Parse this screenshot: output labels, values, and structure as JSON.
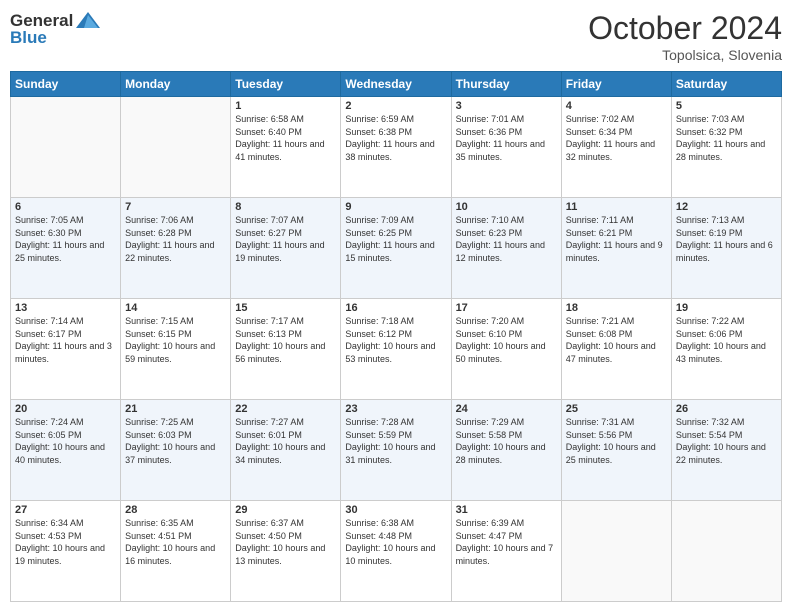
{
  "header": {
    "logo_general": "General",
    "logo_blue": "Blue",
    "month": "October 2024",
    "location": "Topolsica, Slovenia"
  },
  "days_of_week": [
    "Sunday",
    "Monday",
    "Tuesday",
    "Wednesday",
    "Thursday",
    "Friday",
    "Saturday"
  ],
  "weeks": [
    [
      {
        "num": "",
        "info": ""
      },
      {
        "num": "",
        "info": ""
      },
      {
        "num": "1",
        "info": "Sunrise: 6:58 AM\nSunset: 6:40 PM\nDaylight: 11 hours and 41 minutes."
      },
      {
        "num": "2",
        "info": "Sunrise: 6:59 AM\nSunset: 6:38 PM\nDaylight: 11 hours and 38 minutes."
      },
      {
        "num": "3",
        "info": "Sunrise: 7:01 AM\nSunset: 6:36 PM\nDaylight: 11 hours and 35 minutes."
      },
      {
        "num": "4",
        "info": "Sunrise: 7:02 AM\nSunset: 6:34 PM\nDaylight: 11 hours and 32 minutes."
      },
      {
        "num": "5",
        "info": "Sunrise: 7:03 AM\nSunset: 6:32 PM\nDaylight: 11 hours and 28 minutes."
      }
    ],
    [
      {
        "num": "6",
        "info": "Sunrise: 7:05 AM\nSunset: 6:30 PM\nDaylight: 11 hours and 25 minutes."
      },
      {
        "num": "7",
        "info": "Sunrise: 7:06 AM\nSunset: 6:28 PM\nDaylight: 11 hours and 22 minutes."
      },
      {
        "num": "8",
        "info": "Sunrise: 7:07 AM\nSunset: 6:27 PM\nDaylight: 11 hours and 19 minutes."
      },
      {
        "num": "9",
        "info": "Sunrise: 7:09 AM\nSunset: 6:25 PM\nDaylight: 11 hours and 15 minutes."
      },
      {
        "num": "10",
        "info": "Sunrise: 7:10 AM\nSunset: 6:23 PM\nDaylight: 11 hours and 12 minutes."
      },
      {
        "num": "11",
        "info": "Sunrise: 7:11 AM\nSunset: 6:21 PM\nDaylight: 11 hours and 9 minutes."
      },
      {
        "num": "12",
        "info": "Sunrise: 7:13 AM\nSunset: 6:19 PM\nDaylight: 11 hours and 6 minutes."
      }
    ],
    [
      {
        "num": "13",
        "info": "Sunrise: 7:14 AM\nSunset: 6:17 PM\nDaylight: 11 hours and 3 minutes."
      },
      {
        "num": "14",
        "info": "Sunrise: 7:15 AM\nSunset: 6:15 PM\nDaylight: 10 hours and 59 minutes."
      },
      {
        "num": "15",
        "info": "Sunrise: 7:17 AM\nSunset: 6:13 PM\nDaylight: 10 hours and 56 minutes."
      },
      {
        "num": "16",
        "info": "Sunrise: 7:18 AM\nSunset: 6:12 PM\nDaylight: 10 hours and 53 minutes."
      },
      {
        "num": "17",
        "info": "Sunrise: 7:20 AM\nSunset: 6:10 PM\nDaylight: 10 hours and 50 minutes."
      },
      {
        "num": "18",
        "info": "Sunrise: 7:21 AM\nSunset: 6:08 PM\nDaylight: 10 hours and 47 minutes."
      },
      {
        "num": "19",
        "info": "Sunrise: 7:22 AM\nSunset: 6:06 PM\nDaylight: 10 hours and 43 minutes."
      }
    ],
    [
      {
        "num": "20",
        "info": "Sunrise: 7:24 AM\nSunset: 6:05 PM\nDaylight: 10 hours and 40 minutes."
      },
      {
        "num": "21",
        "info": "Sunrise: 7:25 AM\nSunset: 6:03 PM\nDaylight: 10 hours and 37 minutes."
      },
      {
        "num": "22",
        "info": "Sunrise: 7:27 AM\nSunset: 6:01 PM\nDaylight: 10 hours and 34 minutes."
      },
      {
        "num": "23",
        "info": "Sunrise: 7:28 AM\nSunset: 5:59 PM\nDaylight: 10 hours and 31 minutes."
      },
      {
        "num": "24",
        "info": "Sunrise: 7:29 AM\nSunset: 5:58 PM\nDaylight: 10 hours and 28 minutes."
      },
      {
        "num": "25",
        "info": "Sunrise: 7:31 AM\nSunset: 5:56 PM\nDaylight: 10 hours and 25 minutes."
      },
      {
        "num": "26",
        "info": "Sunrise: 7:32 AM\nSunset: 5:54 PM\nDaylight: 10 hours and 22 minutes."
      }
    ],
    [
      {
        "num": "27",
        "info": "Sunrise: 6:34 AM\nSunset: 4:53 PM\nDaylight: 10 hours and 19 minutes."
      },
      {
        "num": "28",
        "info": "Sunrise: 6:35 AM\nSunset: 4:51 PM\nDaylight: 10 hours and 16 minutes."
      },
      {
        "num": "29",
        "info": "Sunrise: 6:37 AM\nSunset: 4:50 PM\nDaylight: 10 hours and 13 minutes."
      },
      {
        "num": "30",
        "info": "Sunrise: 6:38 AM\nSunset: 4:48 PM\nDaylight: 10 hours and 10 minutes."
      },
      {
        "num": "31",
        "info": "Sunrise: 6:39 AM\nSunset: 4:47 PM\nDaylight: 10 hours and 7 minutes."
      },
      {
        "num": "",
        "info": ""
      },
      {
        "num": "",
        "info": ""
      }
    ]
  ]
}
